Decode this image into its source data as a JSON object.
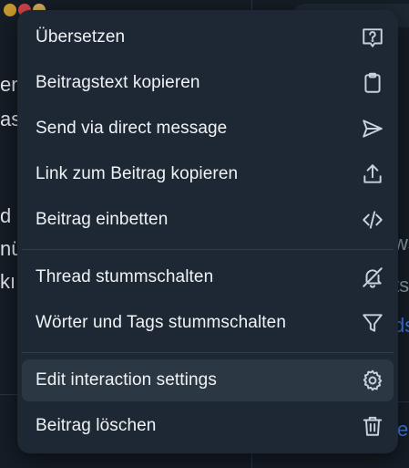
{
  "menu": {
    "items": [
      {
        "label": "Übersetzen",
        "icon": "translate-icon"
      },
      {
        "label": "Beitragstext kopieren",
        "icon": "clipboard-icon"
      },
      {
        "label": "Send via direct message",
        "icon": "send-icon"
      },
      {
        "label": "Link zum Beitrag kopieren",
        "icon": "share-icon"
      },
      {
        "label": "Beitrag einbetten",
        "icon": "code-icon"
      },
      {
        "label": "Thread stummschalten",
        "icon": "bell-mute-icon"
      },
      {
        "label": "Wörter und Tags stummschalten",
        "icon": "filter-icon"
      },
      {
        "label": "Edit interaction settings",
        "icon": "gear-icon"
      },
      {
        "label": "Beitrag löschen",
        "icon": "trash-icon"
      }
    ]
  },
  "background": {
    "fragments": [
      "en",
      "as",
      "d",
      "nü",
      "kı",
      "ws",
      "ts",
      "ds",
      "e"
    ]
  },
  "colors": {
    "menu_bg": "#1e2835",
    "active_item_bg": "#2c3744",
    "text": "#f0f3f6",
    "icon": "#c9d2dc",
    "page_bg": "#151d26",
    "link": "#3a7be6"
  }
}
